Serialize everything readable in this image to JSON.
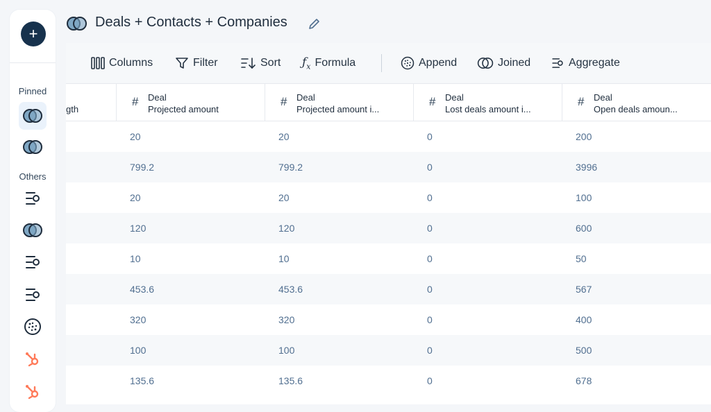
{
  "header": {
    "title": "Deals + Contacts + Companies",
    "icon": "joined-icon"
  },
  "sidebar": {
    "add_label": "+",
    "pinned_label": "Pinned",
    "others_label": "Others",
    "pinned_items": [
      "joined-icon",
      "joined-icon"
    ],
    "other_items": [
      "aggregate-icon",
      "joined-icon",
      "aggregate-icon",
      "aggregate-icon",
      "append-icon",
      "hubspot-icon",
      "hubspot-icon"
    ]
  },
  "toolbar": {
    "columns": "Columns",
    "filter": "Filter",
    "sort": "Sort",
    "formula": "Formula",
    "append": "Append",
    "joined": "Joined",
    "aggregate": "Aggregate"
  },
  "table": {
    "first_col_partial": "gth",
    "columns": [
      {
        "type": "#",
        "line1": "Deal",
        "line2": "Projected amount"
      },
      {
        "type": "#",
        "line1": "Deal",
        "line2": "Projected amount i..."
      },
      {
        "type": "#",
        "line1": "Deal",
        "line2": "Lost deals amount i..."
      },
      {
        "type": "#",
        "line1": "Deal",
        "line2": "Open deals amoun..."
      }
    ],
    "rows": [
      [
        "20",
        "20",
        "0",
        "200"
      ],
      [
        "799.2",
        "799.2",
        "0",
        "3996"
      ],
      [
        "20",
        "20",
        "0",
        "100"
      ],
      [
        "120",
        "120",
        "0",
        "600"
      ],
      [
        "10",
        "10",
        "0",
        "50"
      ],
      [
        "453.6",
        "453.6",
        "0",
        "567"
      ],
      [
        "320",
        "320",
        "0",
        "400"
      ],
      [
        "100",
        "100",
        "0",
        "500"
      ],
      [
        "135.6",
        "135.6",
        "0",
        "678"
      ]
    ]
  },
  "colors": {
    "accent_dark": "#17324d",
    "hubspot_orange": "#ff7a59",
    "joined_fill": "#7fa7c4"
  }
}
